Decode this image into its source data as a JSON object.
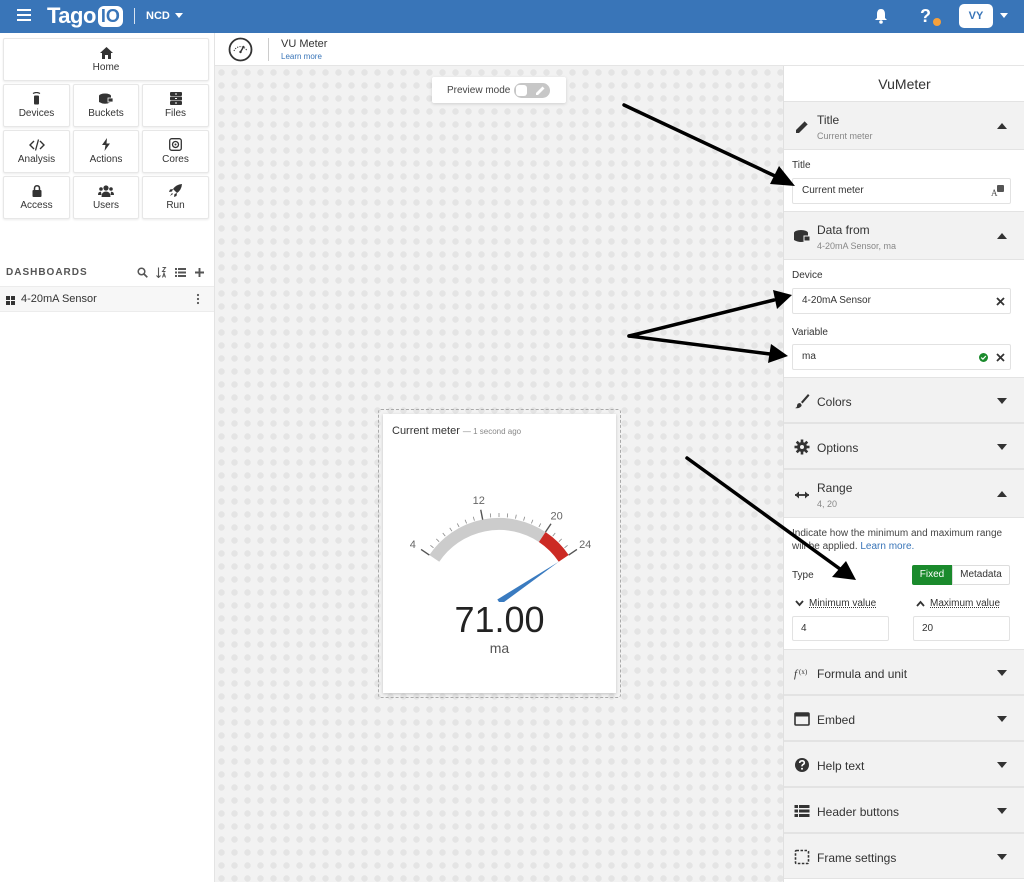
{
  "topbar": {
    "logo_text": "Tago",
    "logo_badge": "IO",
    "org_name": "NCD",
    "help_label": "?",
    "avatar_initials": "VY",
    "bg_color": "#3975b8"
  },
  "sidebar": {
    "tiles": [
      {
        "label": "Home",
        "icon": "home-icon"
      },
      {
        "label": "Devices",
        "icon": "devices-icon"
      },
      {
        "label": "Buckets",
        "icon": "buckets-icon"
      },
      {
        "label": "Files",
        "icon": "files-icon"
      },
      {
        "label": "Analysis",
        "icon": "code-icon"
      },
      {
        "label": "Actions",
        "icon": "bolt-icon"
      },
      {
        "label": "Cores",
        "icon": "cores-icon"
      },
      {
        "label": "Access",
        "icon": "lock-icon"
      },
      {
        "label": "Users",
        "icon": "users-icon"
      },
      {
        "label": "Run",
        "icon": "rocket-icon"
      }
    ],
    "dashboards_title": "DASHBOARDS",
    "dashboard_items": [
      {
        "label": "4-20mA Sensor"
      }
    ]
  },
  "subbar": {
    "title": "VU Meter",
    "learn_more": "Learn more"
  },
  "canvas": {
    "preview_label": "Preview mode",
    "preview_enabled": false
  },
  "widget": {
    "title": "Current meter",
    "time": "— 1 second ago",
    "value": "71.00",
    "unit": "ma",
    "ticks": [
      "4",
      "12",
      "20",
      "24"
    ],
    "min": 4,
    "max": 24,
    "alert_from": 20,
    "needle_value": 71,
    "colors": {
      "track": "#cccccc",
      "alert": "#cc2a24",
      "needle": "#3a7bc0"
    }
  },
  "panel": {
    "title": "VuMeter",
    "sections": {
      "title": {
        "label": "Title",
        "sub": "Current meter",
        "field_label": "Title",
        "field_value": "Current meter"
      },
      "data_from": {
        "label": "Data from",
        "sub": "4-20mA Sensor, ma",
        "device_label": "Device",
        "device_value": "4-20mA Sensor",
        "variable_label": "Variable",
        "variable_value": "ma"
      },
      "colors": {
        "label": "Colors"
      },
      "options": {
        "label": "Options"
      },
      "range": {
        "label": "Range",
        "sub": "4, 20",
        "desc_part1": "Indicate how the minimum and maximum range will be applied. ",
        "desc_link": "Learn more.",
        "type_label": "Type",
        "type_fixed": "Fixed",
        "type_metadata": "Metadata",
        "min_label": "Minimum value",
        "max_label": "Maximum value",
        "min_value": "4",
        "max_value": "20"
      },
      "formula": {
        "label": "Formula and unit"
      },
      "embed": {
        "label": "Embed"
      },
      "help_text": {
        "label": "Help text"
      },
      "header_buttons": {
        "label": "Header buttons"
      },
      "frame_settings": {
        "label": "Frame settings"
      }
    }
  }
}
